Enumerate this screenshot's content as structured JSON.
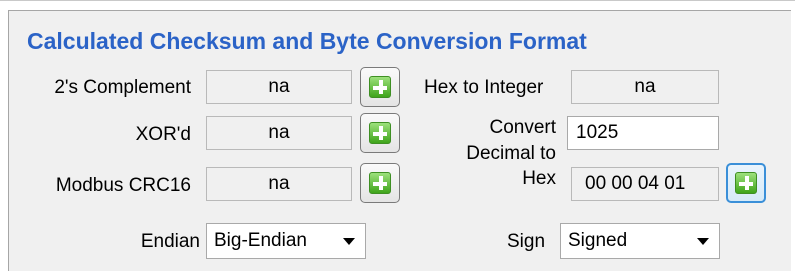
{
  "panel": {
    "title": "Calculated Checksum and Byte Conversion Format"
  },
  "checksums": [
    {
      "label": "2's Complement",
      "value": "na"
    },
    {
      "label": "XOR'd",
      "value": "na"
    },
    {
      "label": "Modbus CRC16",
      "value": "na"
    }
  ],
  "conversion": {
    "hex_to_integer_label": "Hex to Integer",
    "hex_to_integer_value": "na",
    "convert_label_line1": "Convert",
    "convert_label_line2": "Decimal to",
    "convert_label_line3": "Hex",
    "decimal_input_value": "1025",
    "hex_output_value": "00 00 04 01"
  },
  "endian": {
    "label": "Endian",
    "selected": "Big-Endian"
  },
  "sign": {
    "label": "Sign",
    "selected": "Signed"
  },
  "icons": {
    "copy_button_icon": "plus-icon",
    "dropdown_icon": "chevron-down-icon"
  },
  "colors": {
    "title": "#2b63c7",
    "panel_bg": "#f0f0f0",
    "plus_green": "#3fa41b",
    "focus_blue": "#3a8fd8"
  }
}
